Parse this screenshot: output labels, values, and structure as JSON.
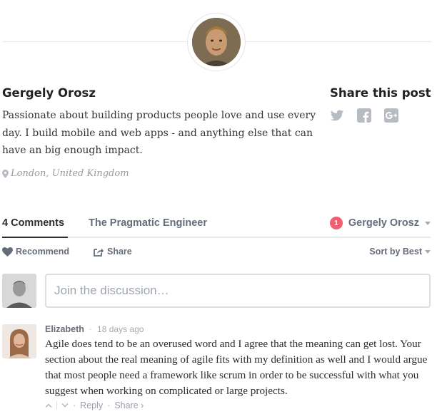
{
  "author": {
    "name": "Gergely Orosz",
    "bio": "Passionate about building products people love and use every day. I build mobile and web apps - and anything else that can have an big enough impact.",
    "location": "London, United Kingdom"
  },
  "share": {
    "title": "Share this post",
    "icons": [
      "twitter-icon",
      "facebook-icon",
      "google-plus-icon"
    ]
  },
  "tabs": {
    "comments": "4 Comments",
    "community": "The Pragmatic Engineer",
    "notification_count": "1",
    "user_name": "Gergely Orosz"
  },
  "actions": {
    "recommend": "Recommend",
    "share": "Share",
    "sort": "Sort by Best"
  },
  "composer": {
    "placeholder": "Join the discussion…"
  },
  "comment": {
    "author": "Elizabeth",
    "time": "18 days ago",
    "body": "Agile does tend to be an overused word and I agree that the meaning can get lost. Your section about the real meaning of agile fits with my definition as well and I would argue that most people need a framework like scrum in order to be successful with what you suggest when working on complicated or large projects.",
    "reply": "Reply",
    "share": "Share ›"
  },
  "colors": {
    "text": "#2a2e2e",
    "muted": "#656c7a",
    "badge": "#f05f70",
    "icon": "#b7bcc2"
  }
}
